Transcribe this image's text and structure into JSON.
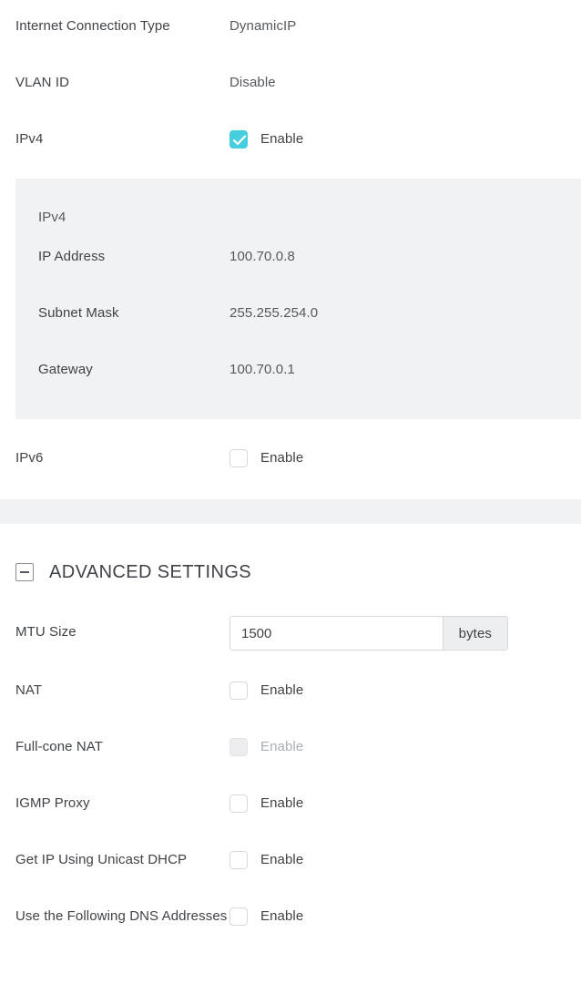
{
  "basic": {
    "rows": [
      {
        "label": "Internet Connection Type",
        "value": "DynamicIP"
      },
      {
        "label": "VLAN ID",
        "value": "Disable"
      }
    ],
    "ipv4_toggle": {
      "label": "IPv4",
      "checkbox_label": "Enable",
      "checked": true
    },
    "ipv6_toggle": {
      "label": "IPv6",
      "checkbox_label": "Enable",
      "checked": false
    }
  },
  "ipv4_panel": {
    "title": "IPv4",
    "rows": [
      {
        "label": "IP Address",
        "value": "100.70.0.8"
      },
      {
        "label": "Subnet Mask",
        "value": "255.255.254.0"
      },
      {
        "label": "Gateway",
        "value": "100.70.0.1"
      }
    ]
  },
  "advanced": {
    "title": "ADVANCED SETTINGS",
    "collapse_icon": "minus-square-icon",
    "mtu": {
      "label": "MTU Size",
      "value": "1500",
      "placeholder": "1500",
      "unit": "bytes"
    },
    "toggles": [
      {
        "label": "NAT",
        "checkbox_label": "Enable",
        "checked": false,
        "disabled": false
      },
      {
        "label": "Full-cone NAT",
        "checkbox_label": "Enable",
        "checked": false,
        "disabled": true
      },
      {
        "label": "IGMP Proxy",
        "checkbox_label": "Enable",
        "checked": false,
        "disabled": false
      },
      {
        "label": "Get IP Using Unicast DHCP",
        "checkbox_label": "Enable",
        "checked": false,
        "disabled": false
      },
      {
        "label": "Use the Following DNS Addresses",
        "checkbox_label": "Enable",
        "checked": false,
        "disabled": false
      }
    ]
  },
  "colors": {
    "accent": "#46cede",
    "panel_bg": "#f1f2f4",
    "label_text": "#3f4247",
    "value_text": "#55585d",
    "disabled_text": "#a9adb3",
    "border": "#d6d8db"
  }
}
